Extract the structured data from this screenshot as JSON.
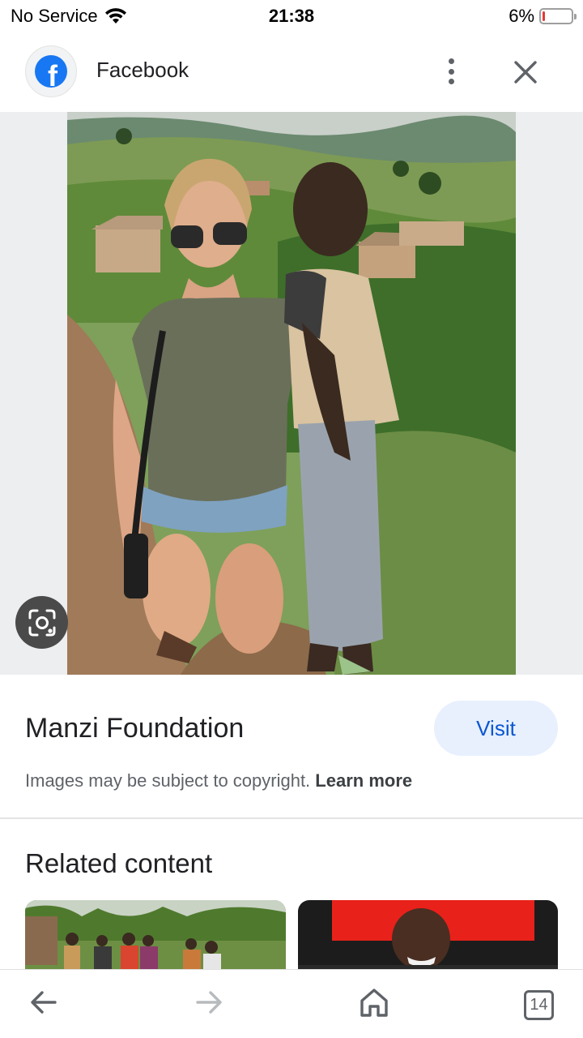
{
  "status_bar": {
    "carrier": "No Service",
    "time": "21:38",
    "battery_percent": "6%",
    "battery_level": 0.06,
    "battery_color": "#e53935"
  },
  "header": {
    "title": "Facebook",
    "logo_icon": "facebook-logo-icon",
    "logo_letter": "f",
    "more_icon": "more-vertical-icon",
    "close_icon": "close-icon",
    "brand_color": "#1877f2"
  },
  "image": {
    "lens_icon": "google-lens-icon"
  },
  "info": {
    "site_name": "Manzi Foundation",
    "visit_label": "Visit",
    "copyright_text": "Images may be subject to copyright.",
    "learn_more_label": "Learn more",
    "accent_color": "#0b57d0"
  },
  "related": {
    "title": "Related content"
  },
  "bottom_nav": {
    "back_icon": "arrow-left-icon",
    "forward_icon": "arrow-right-icon",
    "home_icon": "home-icon",
    "tabs_count": "14"
  }
}
